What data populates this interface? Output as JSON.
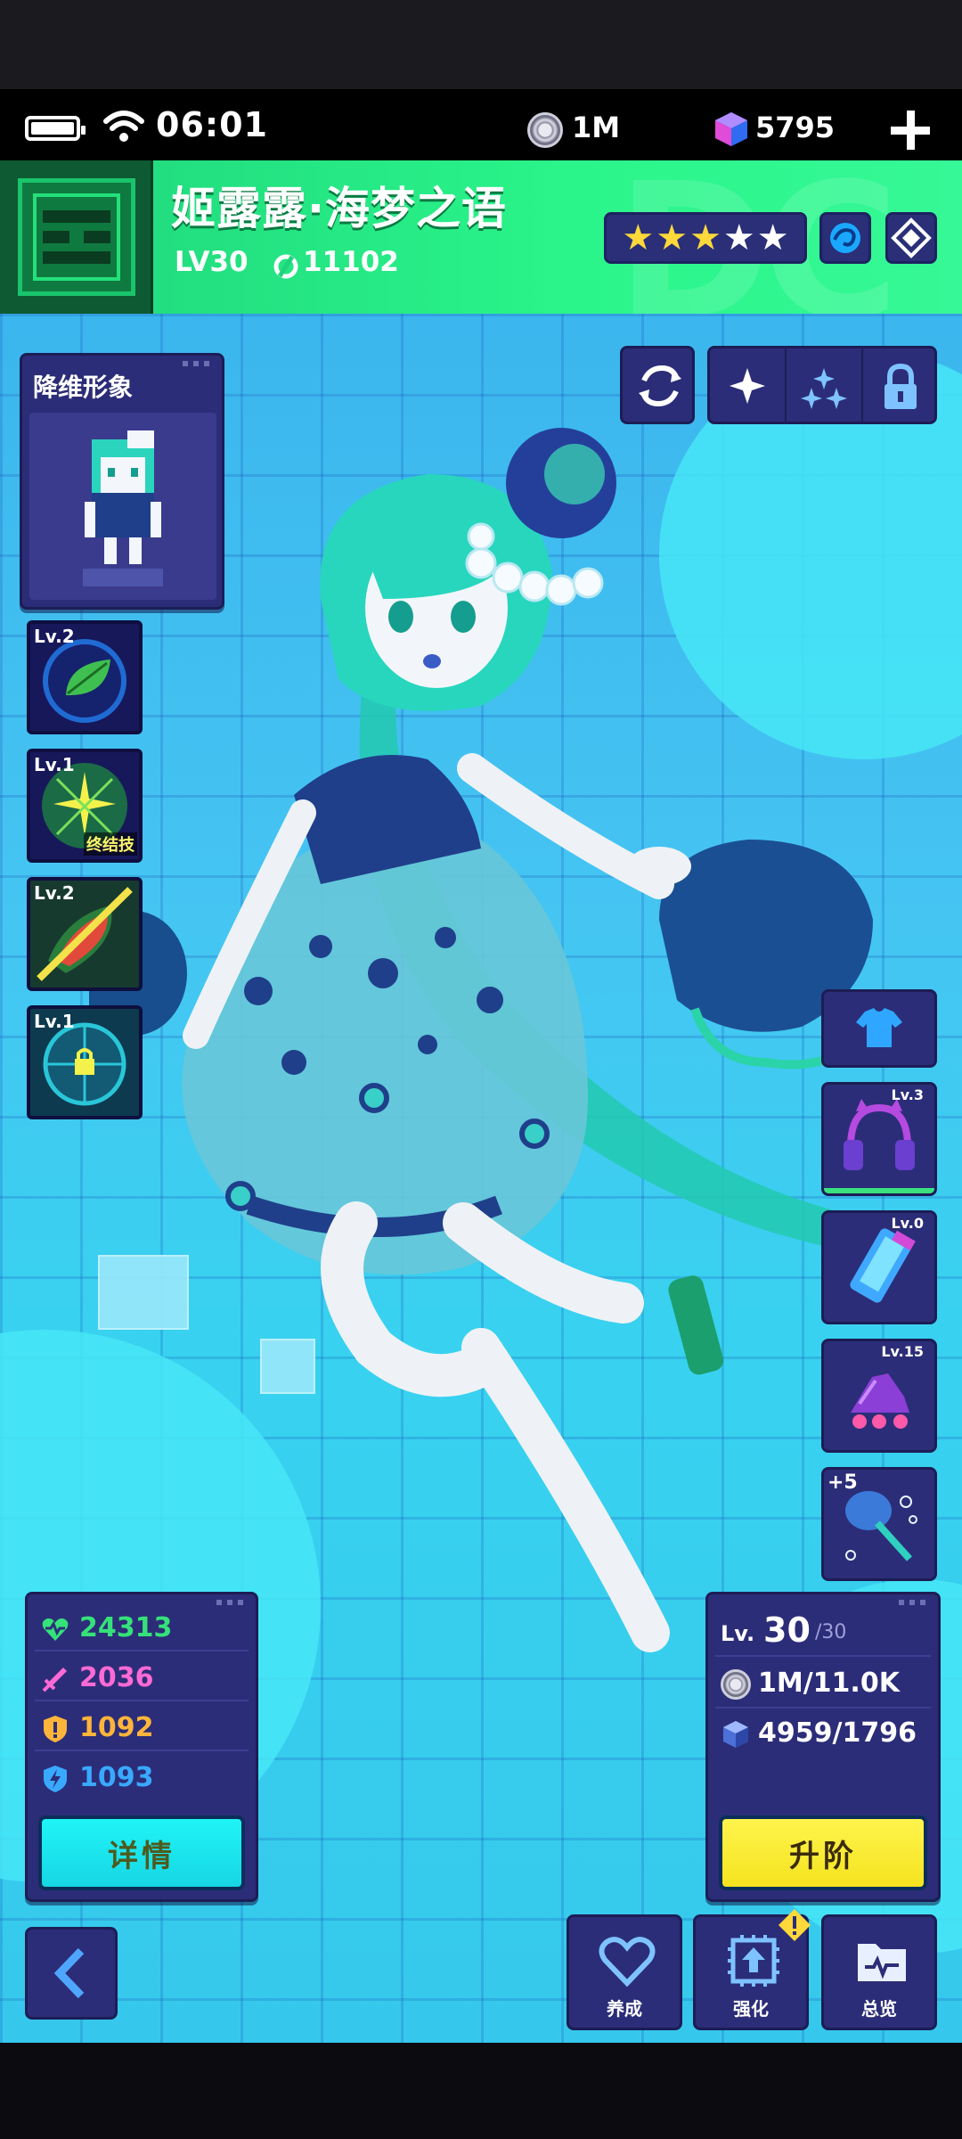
{
  "status_bar": {
    "time": "06:01",
    "coins": "1M",
    "gems": "5795"
  },
  "header": {
    "name": "姬露露·海梦之语",
    "level": "LV30",
    "power": "11102",
    "stars_gold": 3,
    "stars_white": 2
  },
  "pixel_avatar": {
    "title": "降维形象"
  },
  "skills": [
    {
      "level": "Lv.2",
      "tag": ""
    },
    {
      "level": "Lv.1",
      "tag": "终结技"
    },
    {
      "level": "Lv.2",
      "tag": ""
    },
    {
      "level": "Lv.1",
      "tag": ""
    }
  ],
  "equipment": [
    {
      "level": "Lv.3",
      "name": "headphones-icon"
    },
    {
      "level": "Lv.0",
      "name": "phone-icon"
    },
    {
      "level": "Lv.15",
      "name": "skates-icon"
    },
    {
      "level": "+5",
      "name": "jellyfish-wand-icon"
    }
  ],
  "stats": {
    "hp": "24313",
    "attack": "2036",
    "defense": "1092",
    "speed": "1093",
    "details_label": "详情"
  },
  "level_panel": {
    "prefix": "Lv.",
    "level": "30",
    "max": "/30",
    "coins": "1M/11.0K",
    "cubes": "4959/1796",
    "upgrade_label": "升阶"
  },
  "nav": {
    "cultivate": "养成",
    "enhance": "强化",
    "overview": "总览"
  },
  "colors": {
    "header_green": "#2af58a",
    "panel_navy": "#2c2d78",
    "details_cyan": "#1ff4f6",
    "upgrade_yellow": "#fff44c",
    "hp_green": "#35e27a",
    "attack_pink": "#ff6ad5",
    "defense_orange": "#ffb43a",
    "speed_blue": "#39a9ff"
  }
}
